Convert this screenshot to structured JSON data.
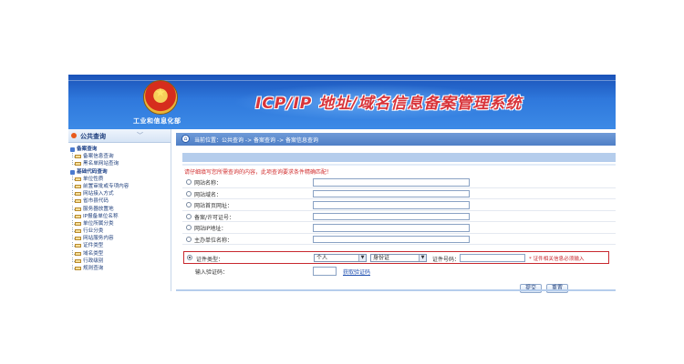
{
  "header": {
    "ministry": "工业和信息化部",
    "title": "ICP/IP 地址/域名信息备案管理系统"
  },
  "sidebar": {
    "title": "公共查询",
    "groups": [
      {
        "label": "备案查询",
        "items": [
          "备案信息查询",
          "黑名单网站查询"
        ]
      },
      {
        "label": "基础代码查询",
        "items": [
          "单位性质",
          "前置审批或专项内容",
          "网站接入方式",
          "省市县代码",
          "服务器放置地",
          "IP报备单位名称",
          "单位所属分类",
          "行业分类",
          "网站服务内容",
          "证件类型",
          "域名类型",
          "行政级别",
          "规则查询"
        ]
      }
    ]
  },
  "main": {
    "breadcrumb": "当前位置：公共查询 -> 备案查询 -> 备案信息查询",
    "notice": "请仔细填写您所需查询的内容，此项查询要求条件精确匹配！",
    "fields": [
      {
        "label": "网站名称：",
        "checked": false
      },
      {
        "label": "网站域名：",
        "checked": false
      },
      {
        "label": "网站首页网址：",
        "checked": false
      },
      {
        "label": "备案/许可证号：",
        "checked": false
      },
      {
        "label": "网站IP地址：",
        "checked": false
      },
      {
        "label": "主办单位名称：",
        "checked": false
      }
    ],
    "id_row": {
      "label": "证件类型：",
      "checked": true,
      "subject_type": "个人",
      "id_type": "身份证",
      "number_label": "证件号码：",
      "hint": "* 证件相关信息必须输入"
    },
    "captcha": {
      "label": "输入验证码：",
      "link": "获取验证码"
    },
    "buttons": {
      "submit": "提交",
      "reset": "重置"
    }
  },
  "colors": {
    "banner": "#2f78dc",
    "title": "#d8343a",
    "highlight": "#c8282e",
    "link": "#1f4fb0"
  }
}
